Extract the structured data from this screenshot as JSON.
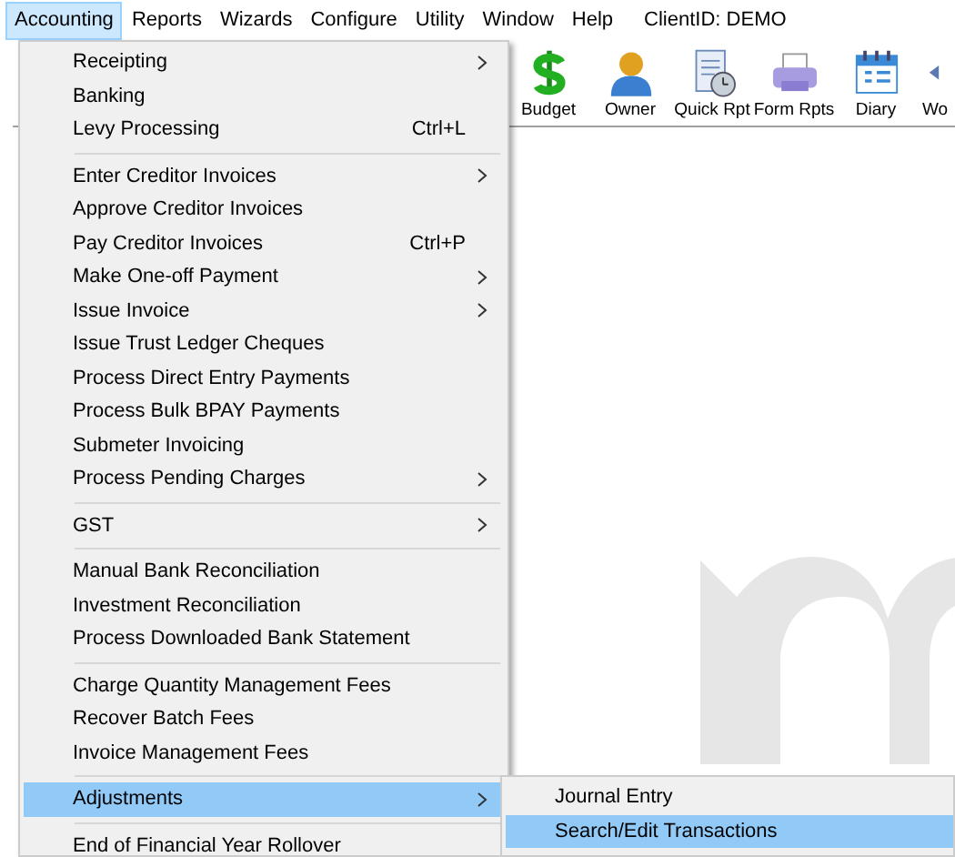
{
  "menubar": [
    {
      "label": "Accounting",
      "selected": true
    },
    {
      "label": "Reports",
      "selected": false
    },
    {
      "label": "Wizards",
      "selected": false
    },
    {
      "label": "Configure",
      "selected": false
    },
    {
      "label": "Utility",
      "selected": false
    },
    {
      "label": "Window",
      "selected": false
    },
    {
      "label": "Help",
      "selected": false
    }
  ],
  "client_id": "ClientID: DEMO",
  "toolbar": [
    {
      "label": "Budget"
    },
    {
      "label": "Owner"
    },
    {
      "label": "Quick Rpt"
    },
    {
      "label": "Form Rpts"
    },
    {
      "label": "Diary"
    },
    {
      "label": "Wo"
    }
  ],
  "menu": [
    {
      "kind": "item",
      "label": "Receipting",
      "submenu": true,
      "selected": false
    },
    {
      "kind": "item",
      "label": "Banking",
      "submenu": false,
      "selected": false
    },
    {
      "kind": "item",
      "label": "Levy Processing",
      "shortcut": "Ctrl+L",
      "submenu": false,
      "selected": false
    },
    {
      "kind": "separator"
    },
    {
      "kind": "item",
      "label": "Enter Creditor Invoices",
      "submenu": true,
      "selected": false
    },
    {
      "kind": "item",
      "label": "Approve Creditor Invoices",
      "submenu": false,
      "selected": false
    },
    {
      "kind": "item",
      "label": "Pay Creditor Invoices",
      "shortcut": "Ctrl+P",
      "submenu": false,
      "selected": false
    },
    {
      "kind": "item",
      "label": "Make One-off Payment",
      "submenu": true,
      "selected": false
    },
    {
      "kind": "item",
      "label": "Issue Invoice",
      "submenu": true,
      "selected": false
    },
    {
      "kind": "item",
      "label": "Issue Trust Ledger Cheques",
      "submenu": false,
      "selected": false
    },
    {
      "kind": "item",
      "label": "Process Direct Entry Payments",
      "submenu": false,
      "selected": false
    },
    {
      "kind": "item",
      "label": "Process Bulk BPAY Payments",
      "submenu": false,
      "selected": false
    },
    {
      "kind": "item",
      "label": "Submeter Invoicing",
      "submenu": false,
      "selected": false
    },
    {
      "kind": "item",
      "label": "Process Pending Charges",
      "submenu": true,
      "selected": false
    },
    {
      "kind": "separator"
    },
    {
      "kind": "item",
      "label": "GST",
      "submenu": true,
      "selected": false
    },
    {
      "kind": "separator"
    },
    {
      "kind": "item",
      "label": "Manual Bank Reconciliation",
      "submenu": false,
      "selected": false
    },
    {
      "kind": "item",
      "label": "Investment Reconciliation",
      "submenu": false,
      "selected": false
    },
    {
      "kind": "item",
      "label": "Process Downloaded Bank Statement",
      "submenu": false,
      "selected": false
    },
    {
      "kind": "separator"
    },
    {
      "kind": "item",
      "label": "Charge Quantity Management Fees",
      "submenu": false,
      "selected": false
    },
    {
      "kind": "item",
      "label": "Recover Batch Fees",
      "submenu": false,
      "selected": false
    },
    {
      "kind": "item",
      "label": "Invoice Management Fees",
      "submenu": false,
      "selected": false
    },
    {
      "kind": "separator"
    },
    {
      "kind": "item",
      "label": "Adjustments",
      "submenu": true,
      "selected": true
    },
    {
      "kind": "separator"
    },
    {
      "kind": "item",
      "label": "End of Financial Year Rollover",
      "submenu": false,
      "selected": false
    }
  ],
  "submenu": [
    {
      "label": "Journal Entry",
      "selected": false
    },
    {
      "label": "Search/Edit Transactions",
      "selected": true
    }
  ]
}
